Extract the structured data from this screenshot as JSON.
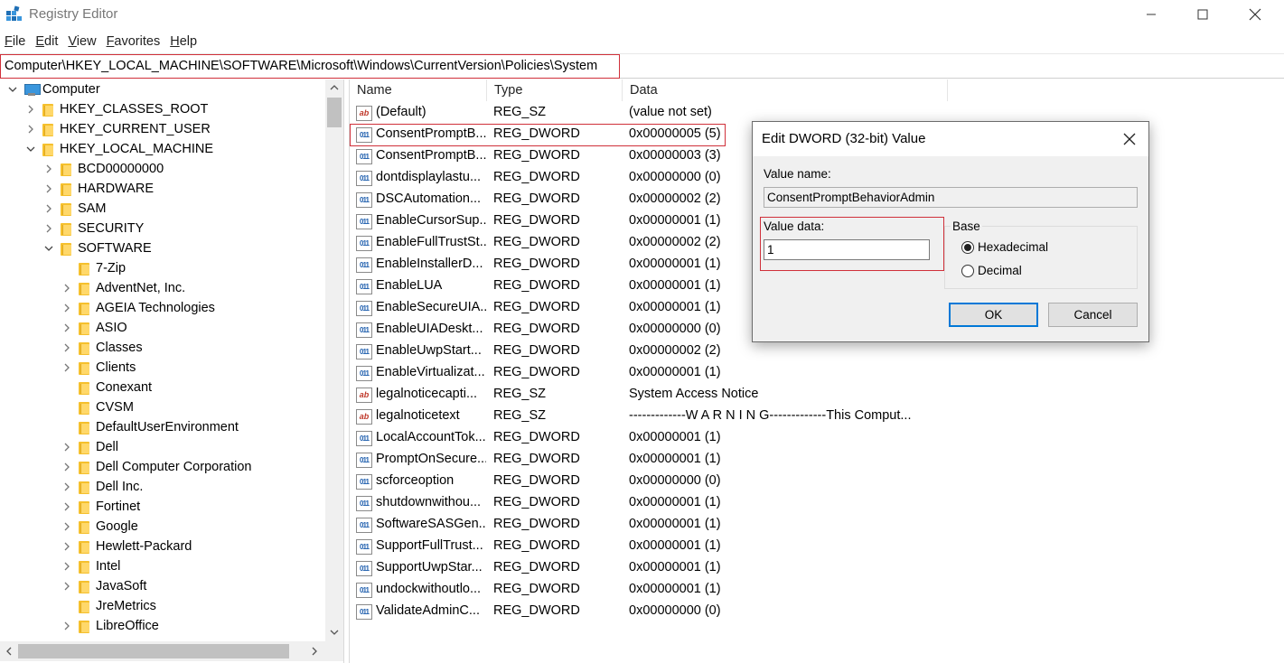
{
  "window": {
    "title": "Registry Editor",
    "icon": "registry-icon"
  },
  "menu": [
    {
      "label": "File",
      "key": "F",
      "rest": "ile"
    },
    {
      "label": "Edit",
      "key": "E",
      "rest": "dit"
    },
    {
      "label": "View",
      "key": "V",
      "rest": "iew"
    },
    {
      "label": "Favorites",
      "key": "F",
      "rest": "avorites"
    },
    {
      "label": "Help",
      "key": "H",
      "rest": "elp"
    }
  ],
  "address": {
    "path": "Computer\\HKEY_LOCAL_MACHINE\\SOFTWARE\\Microsoft\\Windows\\CurrentVersion\\Policies\\System"
  },
  "tree": [
    {
      "label": "Computer",
      "level": 0,
      "state": "expanded",
      "icon": "computer-icon"
    },
    {
      "label": "HKEY_CLASSES_ROOT",
      "level": 1,
      "state": "collapsed",
      "icon": "folder-icon"
    },
    {
      "label": "HKEY_CURRENT_USER",
      "level": 1,
      "state": "collapsed",
      "icon": "folder-icon"
    },
    {
      "label": "HKEY_LOCAL_MACHINE",
      "level": 1,
      "state": "expanded",
      "icon": "folder-icon"
    },
    {
      "label": "BCD00000000",
      "level": 2,
      "state": "collapsed",
      "icon": "folder-icon"
    },
    {
      "label": "HARDWARE",
      "level": 2,
      "state": "collapsed",
      "icon": "folder-icon"
    },
    {
      "label": "SAM",
      "level": 2,
      "state": "collapsed",
      "icon": "folder-icon"
    },
    {
      "label": "SECURITY",
      "level": 2,
      "state": "collapsed",
      "icon": "folder-icon"
    },
    {
      "label": "SOFTWARE",
      "level": 2,
      "state": "expanded",
      "icon": "folder-icon"
    },
    {
      "label": "7-Zip",
      "level": 3,
      "state": "none",
      "icon": "folder-icon"
    },
    {
      "label": "AdventNet, Inc.",
      "level": 3,
      "state": "collapsed",
      "icon": "folder-icon"
    },
    {
      "label": "AGEIA Technologies",
      "level": 3,
      "state": "collapsed",
      "icon": "folder-icon"
    },
    {
      "label": "ASIO",
      "level": 3,
      "state": "collapsed",
      "icon": "folder-icon"
    },
    {
      "label": "Classes",
      "level": 3,
      "state": "collapsed",
      "icon": "folder-icon"
    },
    {
      "label": "Clients",
      "level": 3,
      "state": "collapsed",
      "icon": "folder-icon"
    },
    {
      "label": "Conexant",
      "level": 3,
      "state": "none",
      "icon": "folder-icon"
    },
    {
      "label": "CVSM",
      "level": 3,
      "state": "none",
      "icon": "folder-icon"
    },
    {
      "label": "DefaultUserEnvironment",
      "level": 3,
      "state": "none",
      "icon": "folder-icon"
    },
    {
      "label": "Dell",
      "level": 3,
      "state": "collapsed",
      "icon": "folder-icon"
    },
    {
      "label": "Dell Computer Corporation",
      "level": 3,
      "state": "collapsed",
      "icon": "folder-icon"
    },
    {
      "label": "Dell Inc.",
      "level": 3,
      "state": "collapsed",
      "icon": "folder-icon"
    },
    {
      "label": "Fortinet",
      "level": 3,
      "state": "collapsed",
      "icon": "folder-icon"
    },
    {
      "label": "Google",
      "level": 3,
      "state": "collapsed",
      "icon": "folder-icon"
    },
    {
      "label": "Hewlett-Packard",
      "level": 3,
      "state": "collapsed",
      "icon": "folder-icon"
    },
    {
      "label": "Intel",
      "level": 3,
      "state": "collapsed",
      "icon": "folder-icon"
    },
    {
      "label": "JavaSoft",
      "level": 3,
      "state": "collapsed",
      "icon": "folder-icon"
    },
    {
      "label": "JreMetrics",
      "level": 3,
      "state": "none",
      "icon": "folder-icon"
    },
    {
      "label": "LibreOffice",
      "level": 3,
      "state": "collapsed",
      "icon": "folder-icon"
    }
  ],
  "list": {
    "columns": [
      "Name",
      "Type",
      "Data"
    ],
    "rows": [
      {
        "name": "(Default)",
        "type": "REG_SZ",
        "data": "(value not set)",
        "icon": "string-value-icon"
      },
      {
        "name": "ConsentPromptB...",
        "type": "REG_DWORD",
        "data": "0x00000005 (5)",
        "icon": "binary-value-icon",
        "highlighted": true
      },
      {
        "name": "ConsentPromptB...",
        "type": "REG_DWORD",
        "data": "0x00000003 (3)",
        "icon": "binary-value-icon"
      },
      {
        "name": "dontdisplaylastu...",
        "type": "REG_DWORD",
        "data": "0x00000000 (0)",
        "icon": "binary-value-icon"
      },
      {
        "name": "DSCAutomation...",
        "type": "REG_DWORD",
        "data": "0x00000002 (2)",
        "icon": "binary-value-icon"
      },
      {
        "name": "EnableCursorSup...",
        "type": "REG_DWORD",
        "data": "0x00000001 (1)",
        "icon": "binary-value-icon"
      },
      {
        "name": "EnableFullTrustSt...",
        "type": "REG_DWORD",
        "data": "0x00000002 (2)",
        "icon": "binary-value-icon"
      },
      {
        "name": "EnableInstallerD...",
        "type": "REG_DWORD",
        "data": "0x00000001 (1)",
        "icon": "binary-value-icon"
      },
      {
        "name": "EnableLUA",
        "type": "REG_DWORD",
        "data": "0x00000001 (1)",
        "icon": "binary-value-icon"
      },
      {
        "name": "EnableSecureUIA...",
        "type": "REG_DWORD",
        "data": "0x00000001 (1)",
        "icon": "binary-value-icon"
      },
      {
        "name": "EnableUIADeskt...",
        "type": "REG_DWORD",
        "data": "0x00000000 (0)",
        "icon": "binary-value-icon"
      },
      {
        "name": "EnableUwpStart...",
        "type": "REG_DWORD",
        "data": "0x00000002 (2)",
        "icon": "binary-value-icon"
      },
      {
        "name": "EnableVirtualizat...",
        "type": "REG_DWORD",
        "data": "0x00000001 (1)",
        "icon": "binary-value-icon"
      },
      {
        "name": "legalnoticecapti...",
        "type": "REG_SZ",
        "data": "System Access Notice",
        "icon": "string-value-icon"
      },
      {
        "name": "legalnoticetext",
        "type": "REG_SZ",
        "data": "-------------W A R N I N G-------------This Comput...",
        "icon": "string-value-icon"
      },
      {
        "name": "LocalAccountTok...",
        "type": "REG_DWORD",
        "data": "0x00000001 (1)",
        "icon": "binary-value-icon"
      },
      {
        "name": "PromptOnSecure...",
        "type": "REG_DWORD",
        "data": "0x00000001 (1)",
        "icon": "binary-value-icon"
      },
      {
        "name": "scforceoption",
        "type": "REG_DWORD",
        "data": "0x00000000 (0)",
        "icon": "binary-value-icon"
      },
      {
        "name": "shutdownwithou...",
        "type": "REG_DWORD",
        "data": "0x00000001 (1)",
        "icon": "binary-value-icon"
      },
      {
        "name": "SoftwareSASGen...",
        "type": "REG_DWORD",
        "data": "0x00000001 (1)",
        "icon": "binary-value-icon"
      },
      {
        "name": "SupportFullTrust...",
        "type": "REG_DWORD",
        "data": "0x00000001 (1)",
        "icon": "binary-value-icon"
      },
      {
        "name": "SupportUwpStar...",
        "type": "REG_DWORD",
        "data": "0x00000001 (1)",
        "icon": "binary-value-icon"
      },
      {
        "name": "undockwithoutlo...",
        "type": "REG_DWORD",
        "data": "0x00000001 (1)",
        "icon": "binary-value-icon"
      },
      {
        "name": "ValidateAdminC...",
        "type": "REG_DWORD",
        "data": "0x00000000 (0)",
        "icon": "binary-value-icon"
      }
    ]
  },
  "dialog": {
    "title": "Edit DWORD (32-bit) Value",
    "value_name_label": "Value name:",
    "value_name_label_key": "n",
    "value_name": "ConsentPromptBehaviorAdmin",
    "value_data_label": "Value data:",
    "value_data_label_key": "d",
    "value_data": "1",
    "base_label": "Base",
    "hex_label": "Hexadecimal",
    "hex_key": "H",
    "dec_label": "Decimal",
    "dec_key": "D",
    "selected_base": "Hexadecimal",
    "ok_label": "OK",
    "cancel_label": "Cancel"
  },
  "colors": {
    "highlight": "#d0303a",
    "accent": "#0078d7"
  }
}
